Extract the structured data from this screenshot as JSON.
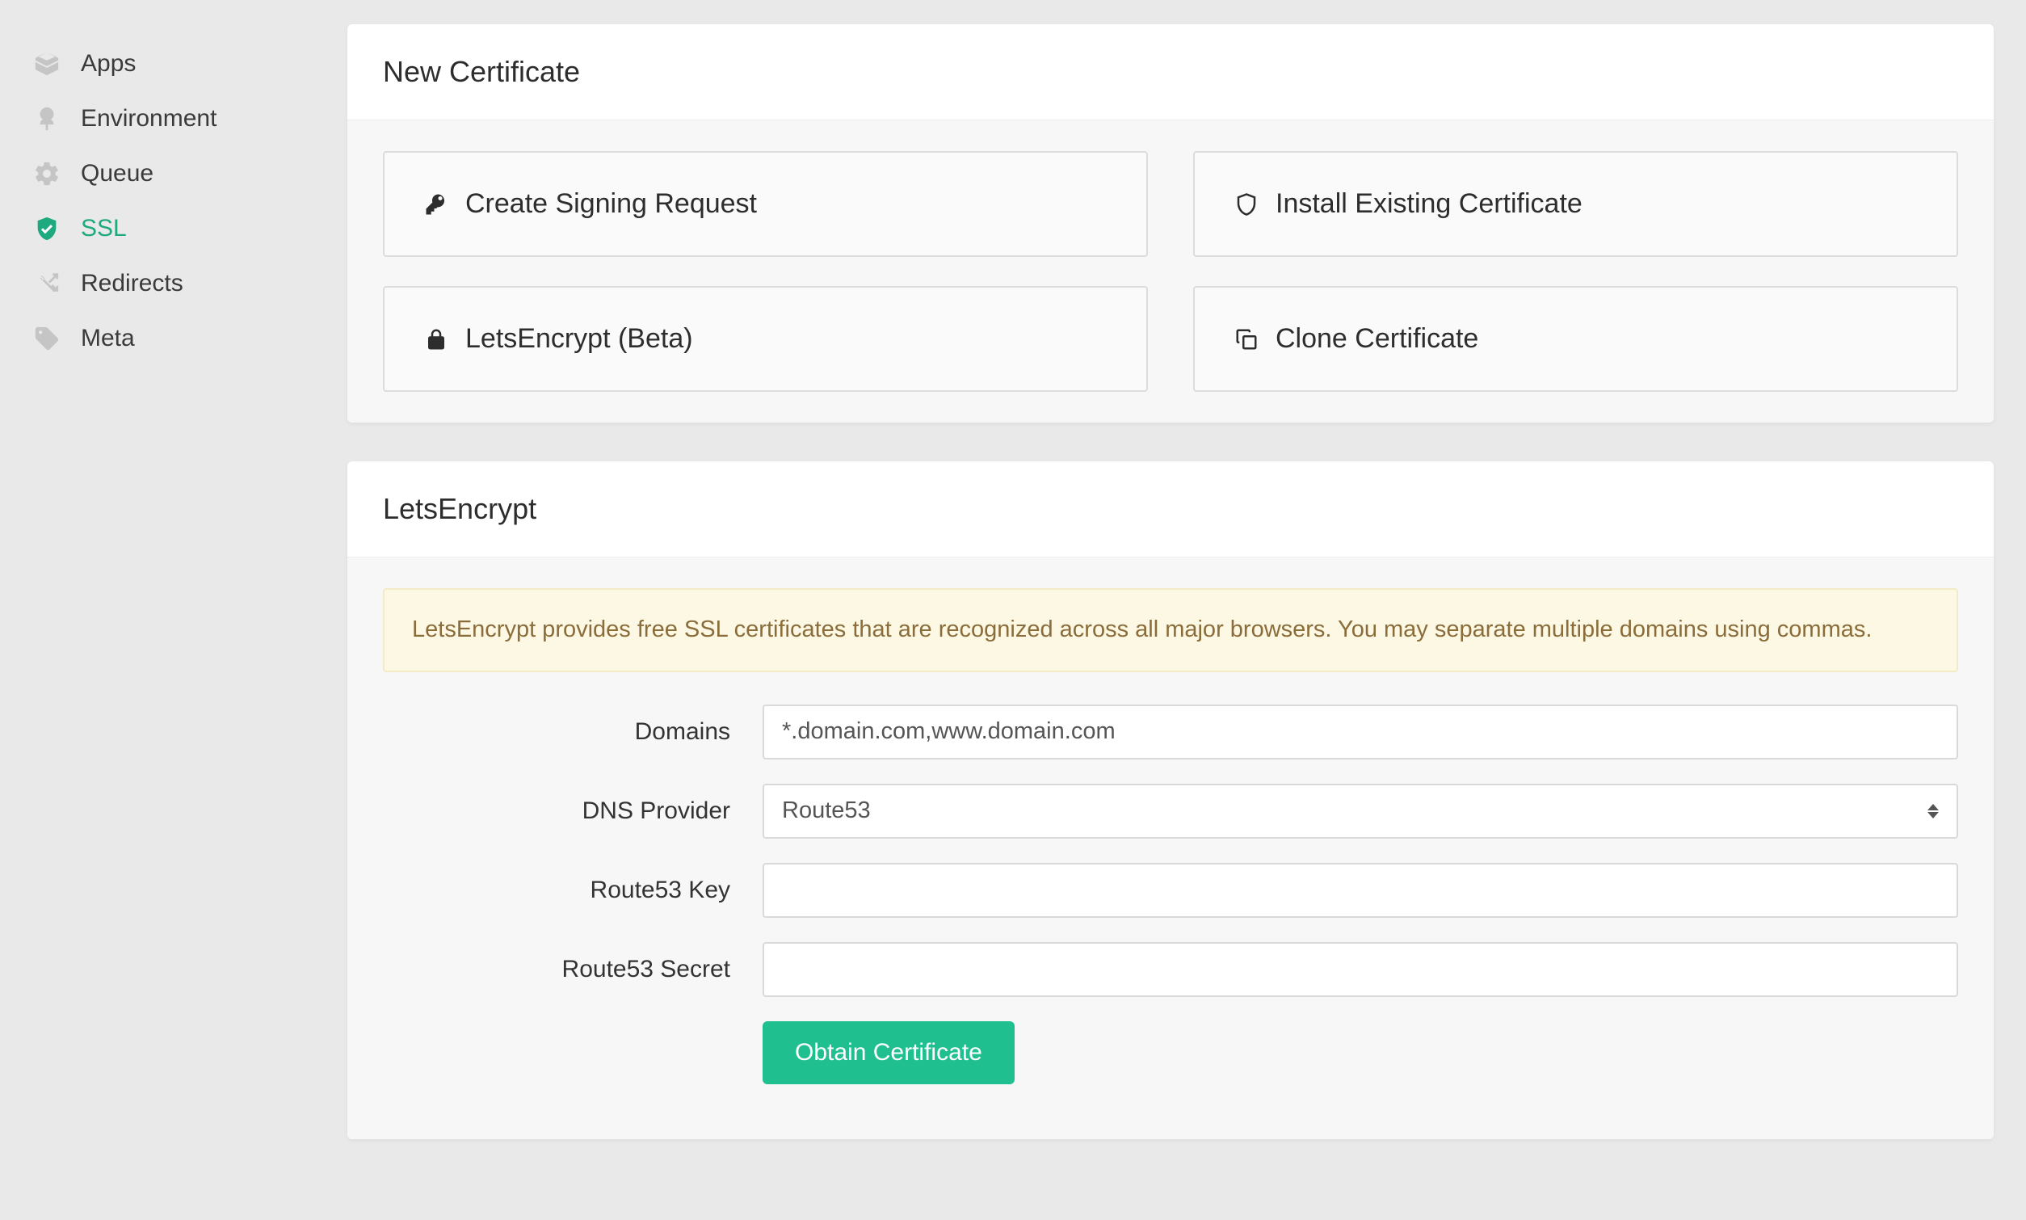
{
  "sidebar": {
    "items": [
      {
        "label": "Apps"
      },
      {
        "label": "Environment"
      },
      {
        "label": "Queue"
      },
      {
        "label": "SSL"
      },
      {
        "label": "Redirects"
      },
      {
        "label": "Meta"
      }
    ]
  },
  "new_cert": {
    "title": "New Certificate",
    "options": {
      "csr": "Create Signing Request",
      "install": "Install Existing Certificate",
      "letsencrypt": "LetsEncrypt (Beta)",
      "clone": "Clone Certificate"
    }
  },
  "letsencrypt": {
    "title": "LetsEncrypt",
    "alert": "LetsEncrypt provides free SSL certificates that are recognized across all major browsers. You may separate multiple domains using commas.",
    "fields": {
      "domains_label": "Domains",
      "domains_value": "*.domain.com,www.domain.com",
      "dns_provider_label": "DNS Provider",
      "dns_provider_value": "Route53",
      "route53_key_label": "Route53 Key",
      "route53_key_value": "",
      "route53_secret_label": "Route53 Secret",
      "route53_secret_value": ""
    },
    "submit_label": "Obtain Certificate"
  }
}
